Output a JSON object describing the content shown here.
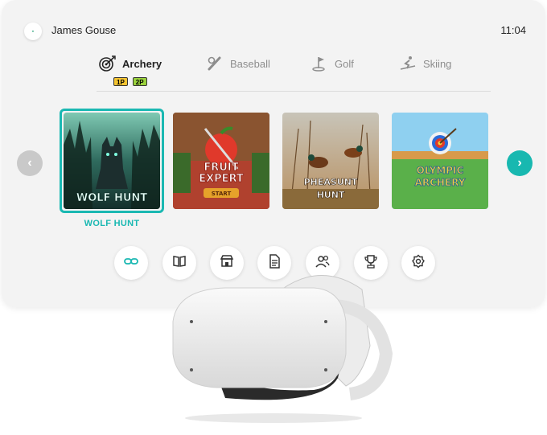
{
  "header": {
    "username": "James Gouse",
    "time": "11:04",
    "logo_icon": "brand-logo-icon"
  },
  "tabs": [
    {
      "label": "Archery",
      "icon": "archery-target-icon",
      "active": true
    },
    {
      "label": "Baseball",
      "icon": "baseball-icon",
      "active": false
    },
    {
      "label": "Golf",
      "icon": "golf-flag-icon",
      "active": false
    },
    {
      "label": "Skiing",
      "icon": "skiing-icon",
      "active": false
    }
  ],
  "player_badges": [
    "1P",
    "2P"
  ],
  "games": [
    {
      "art_title_line1": "WOLF HUNT",
      "art_title_line2": "",
      "selected": true
    },
    {
      "art_title_line1": "FRUIT",
      "art_title_line2": "EXPERT",
      "art_button": "START",
      "selected": false
    },
    {
      "art_title_line1": "PHEASUNT",
      "art_title_line2": "HUNT",
      "selected": false
    },
    {
      "art_title_line1": "OLYMPIC",
      "art_title_line2": "ARCHERY",
      "selected": false
    }
  ],
  "selected_game_title": "WOLF HUNT",
  "dock": [
    {
      "icon": "link-icon"
    },
    {
      "icon": "book-icon"
    },
    {
      "icon": "store-icon"
    },
    {
      "icon": "document-icon"
    },
    {
      "icon": "users-icon"
    },
    {
      "icon": "trophy-icon"
    },
    {
      "icon": "settings-icon"
    }
  ],
  "colors": {
    "accent": "#1ab8b2",
    "panel_bg": "#f3f3f3",
    "badge_1p": "#f4c430",
    "badge_2p": "#9ad23c"
  }
}
